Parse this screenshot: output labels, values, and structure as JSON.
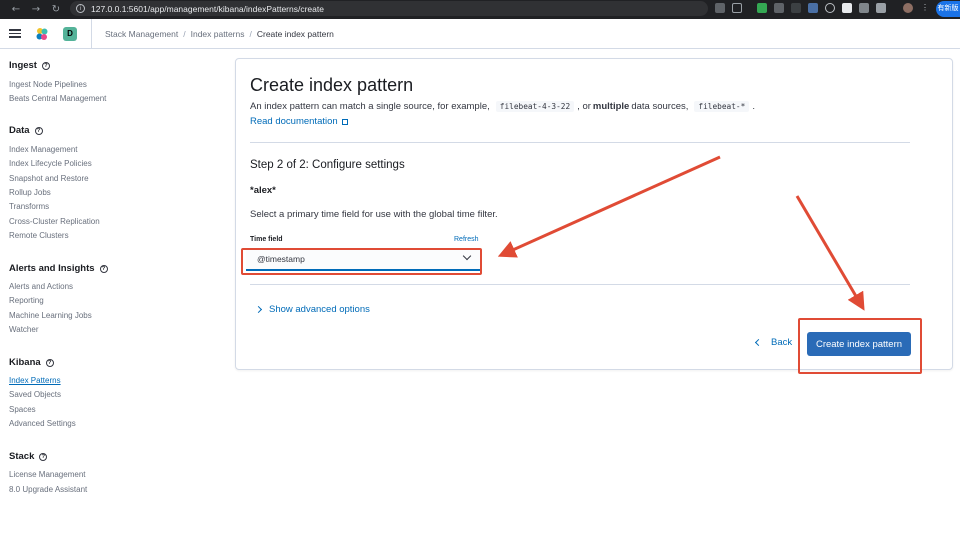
{
  "browser": {
    "url": "127.0.0.1:5601/app/management/kibana/indexPatterns/create",
    "badge": "有新版"
  },
  "header": {
    "space_initial": "D",
    "breadcrumbs": [
      "Stack Management",
      "Index patterns",
      "Create index pattern"
    ]
  },
  "sidebar": {
    "sections": [
      {
        "title": "Ingest",
        "items": [
          "Ingest Node Pipelines",
          "Beats Central Management"
        ]
      },
      {
        "title": "Data",
        "items": [
          "Index Management",
          "Index Lifecycle Policies",
          "Snapshot and Restore",
          "Rollup Jobs",
          "Transforms",
          "Cross-Cluster Replication",
          "Remote Clusters"
        ]
      },
      {
        "title": "Alerts and Insights",
        "items": [
          "Alerts and Actions",
          "Reporting",
          "Machine Learning Jobs",
          "Watcher"
        ]
      },
      {
        "title": "Kibana",
        "items": [
          "Index Patterns",
          "Saved Objects",
          "Spaces",
          "Advanced Settings"
        ]
      },
      {
        "title": "Stack",
        "items": [
          "License Management",
          "8.0 Upgrade Assistant"
        ]
      }
    ]
  },
  "main": {
    "title": "Create index pattern",
    "desc_part1": "An index pattern can match a single source, for example,",
    "desc_code1": "filebeat-4-3-22",
    "desc_part2": ", or",
    "desc_bold": "multiple",
    "desc_part3": "data sources,",
    "desc_code2": "filebeat-*",
    "desc_part4": ".",
    "read_doc": "Read documentation",
    "step_title": "Step 2 of 2: Configure settings",
    "pattern_name": "*alex*",
    "help_text": "Select a primary time field for use with the global time filter.",
    "time_field_label": "Time field",
    "refresh_label": "Refresh",
    "time_field_value": "@timestamp",
    "advanced_label": "Show advanced options",
    "back_label": "Back",
    "create_label": "Create index pattern"
  },
  "colors": {
    "accent": "#006bb8",
    "primary_button": "#2a6bb7",
    "annotation": "#e04b35"
  }
}
